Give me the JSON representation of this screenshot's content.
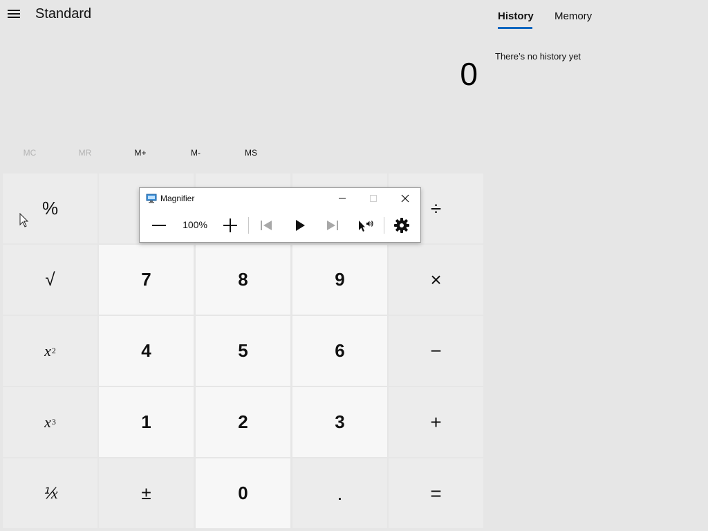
{
  "header": {
    "title": "Standard",
    "menu_icon": "hamburger-icon"
  },
  "display": {
    "value": "0"
  },
  "side_panel": {
    "tabs": [
      {
        "label": "History",
        "active": true
      },
      {
        "label": "Memory",
        "active": false
      }
    ],
    "history_empty": "There’s no history yet"
  },
  "memory_buttons": [
    {
      "label": "MC",
      "enabled": false
    },
    {
      "label": "MR",
      "enabled": false
    },
    {
      "label": "M+",
      "enabled": true
    },
    {
      "label": "M-",
      "enabled": true
    },
    {
      "label": "MS",
      "enabled": true
    }
  ],
  "keys": {
    "percent": "%",
    "divide": "÷",
    "sqrt": "√",
    "seven": "7",
    "eight": "8",
    "nine": "9",
    "multiply": "×",
    "square_base": "x",
    "square_exp": "2",
    "four": "4",
    "five": "5",
    "six": "6",
    "minus": "−",
    "cube_base": "x",
    "cube_exp": "3",
    "one": "1",
    "two": "2",
    "three": "3",
    "plus": "+",
    "reciprocal": "⅟x",
    "negate": "±",
    "zero": "0",
    "decimal": ".",
    "equals": "="
  },
  "magnifier": {
    "title": "Magnifier",
    "zoom_level": "100%",
    "icons": [
      "zoom-out-icon",
      "zoom-in-icon",
      "previous-icon",
      "play-icon",
      "next-icon",
      "read-from-pointer-icon",
      "settings-icon"
    ]
  },
  "colors": {
    "accent": "#0067c0",
    "background": "#e6e6e6",
    "number_key": "#f7f7f7",
    "operator_key": "#ececec"
  }
}
